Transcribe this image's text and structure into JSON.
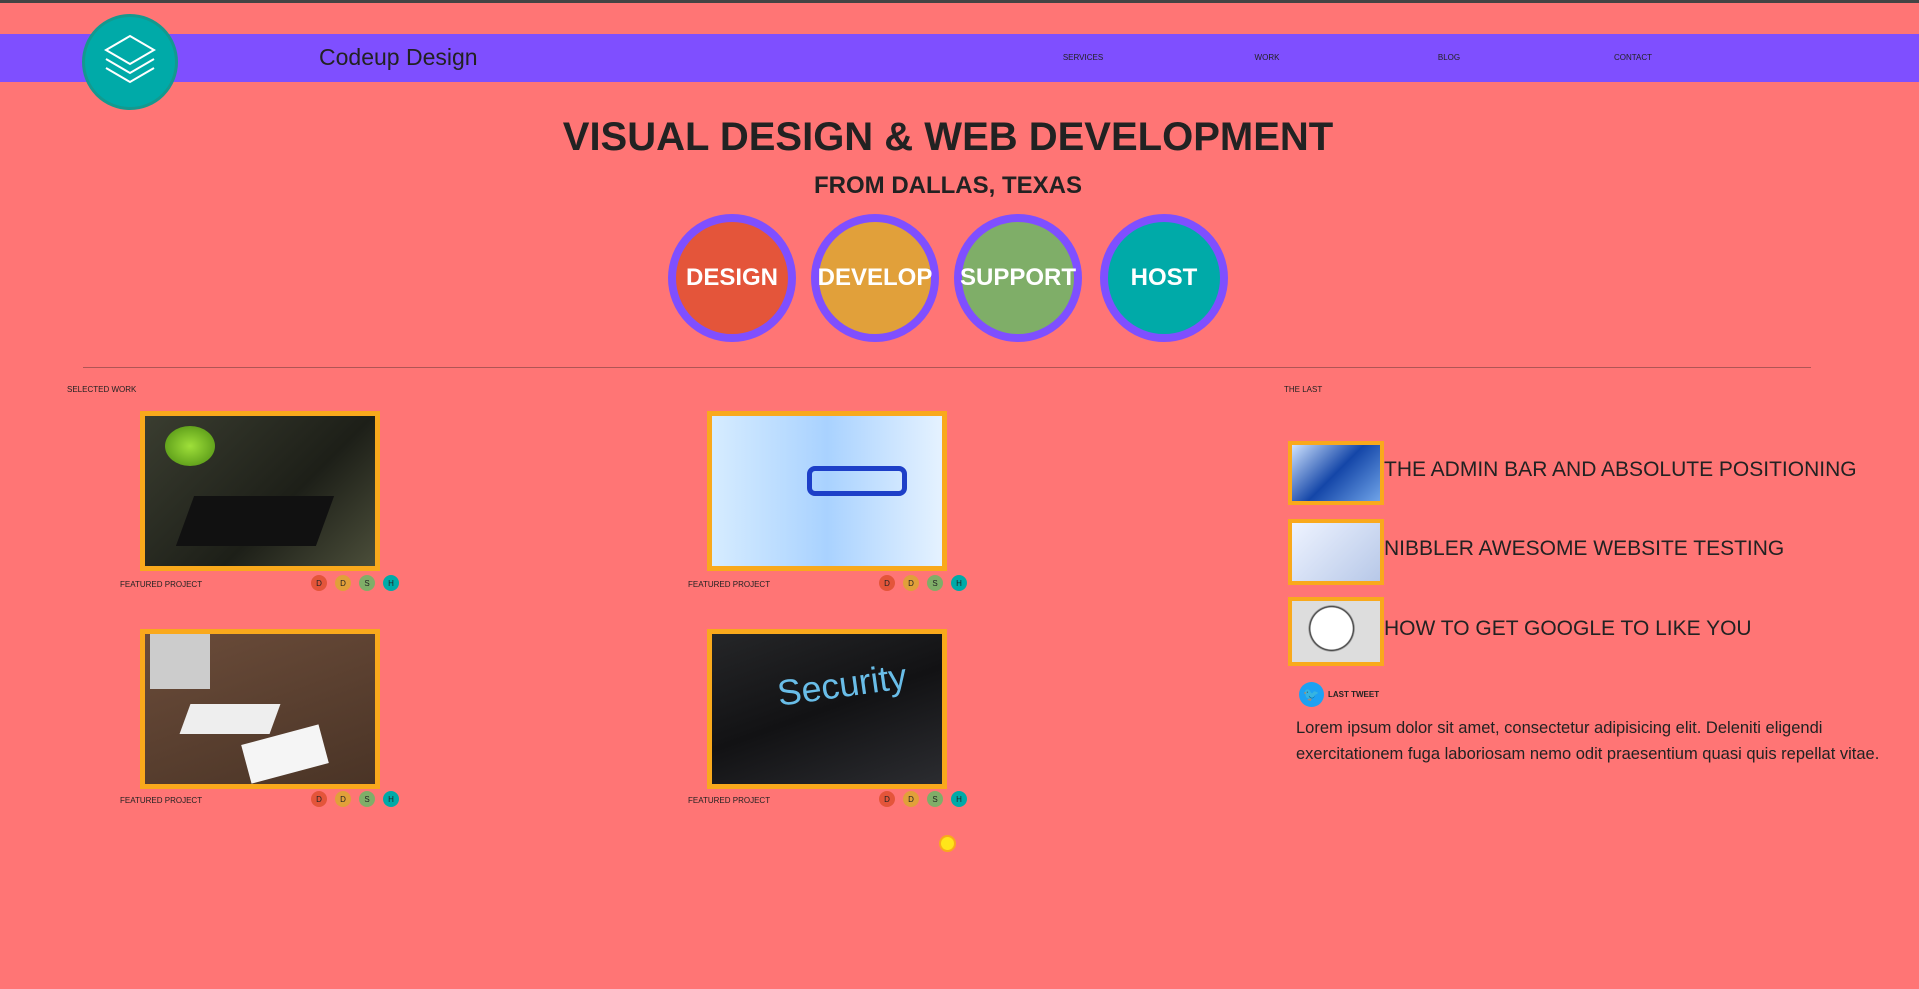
{
  "header": {
    "brand": "Codeup Design",
    "nav": [
      "SERVICES",
      "WORK",
      "BLOG",
      "CONTACT"
    ]
  },
  "hero": {
    "title": "VISUAL DESIGN & WEB DEVELOPMENT",
    "subtitle": "FROM DALLAS, TEXAS",
    "services": [
      {
        "label": "DESIGN",
        "color": "#e4553a"
      },
      {
        "label": "DEVELOP",
        "color": "#e1a03a"
      },
      {
        "label": "SUPPORT",
        "color": "#7fae68"
      },
      {
        "label": "HOST",
        "color": "#00aaa8"
      }
    ]
  },
  "work": {
    "heading": "SELECTED WORK",
    "projects": [
      {
        "label": "FEATURED PROJECT",
        "image": "apples-keyboard-tablet"
      },
      {
        "label": "FEATURED PROJECT",
        "image": "man-glasses-binary"
      },
      {
        "label": "FEATURED PROJECT",
        "image": "imac-laptop-desk"
      },
      {
        "label": "FEATURED PROJECT",
        "image": "security-keyboard"
      }
    ],
    "badges": [
      "D",
      "D",
      "S",
      "H"
    ]
  },
  "blog": {
    "heading": "THE LAST",
    "posts": [
      {
        "title": "THE ADMIN BAR AND ABSOLUTE POSITIONING"
      },
      {
        "title": "NIBBLER AWESOME WEBSITE TESTING"
      },
      {
        "title": "HOW TO GET GOOGLE TO LIKE YOU"
      }
    ],
    "tweet_label": "LAST TWEET",
    "tweet": "Lorem ipsum dolor sit amet, consectetur adipisicing elit. Deleniti eligendi exercitationem fuga laboriosam nemo odit praesentium quasi quis repellat vitae."
  }
}
